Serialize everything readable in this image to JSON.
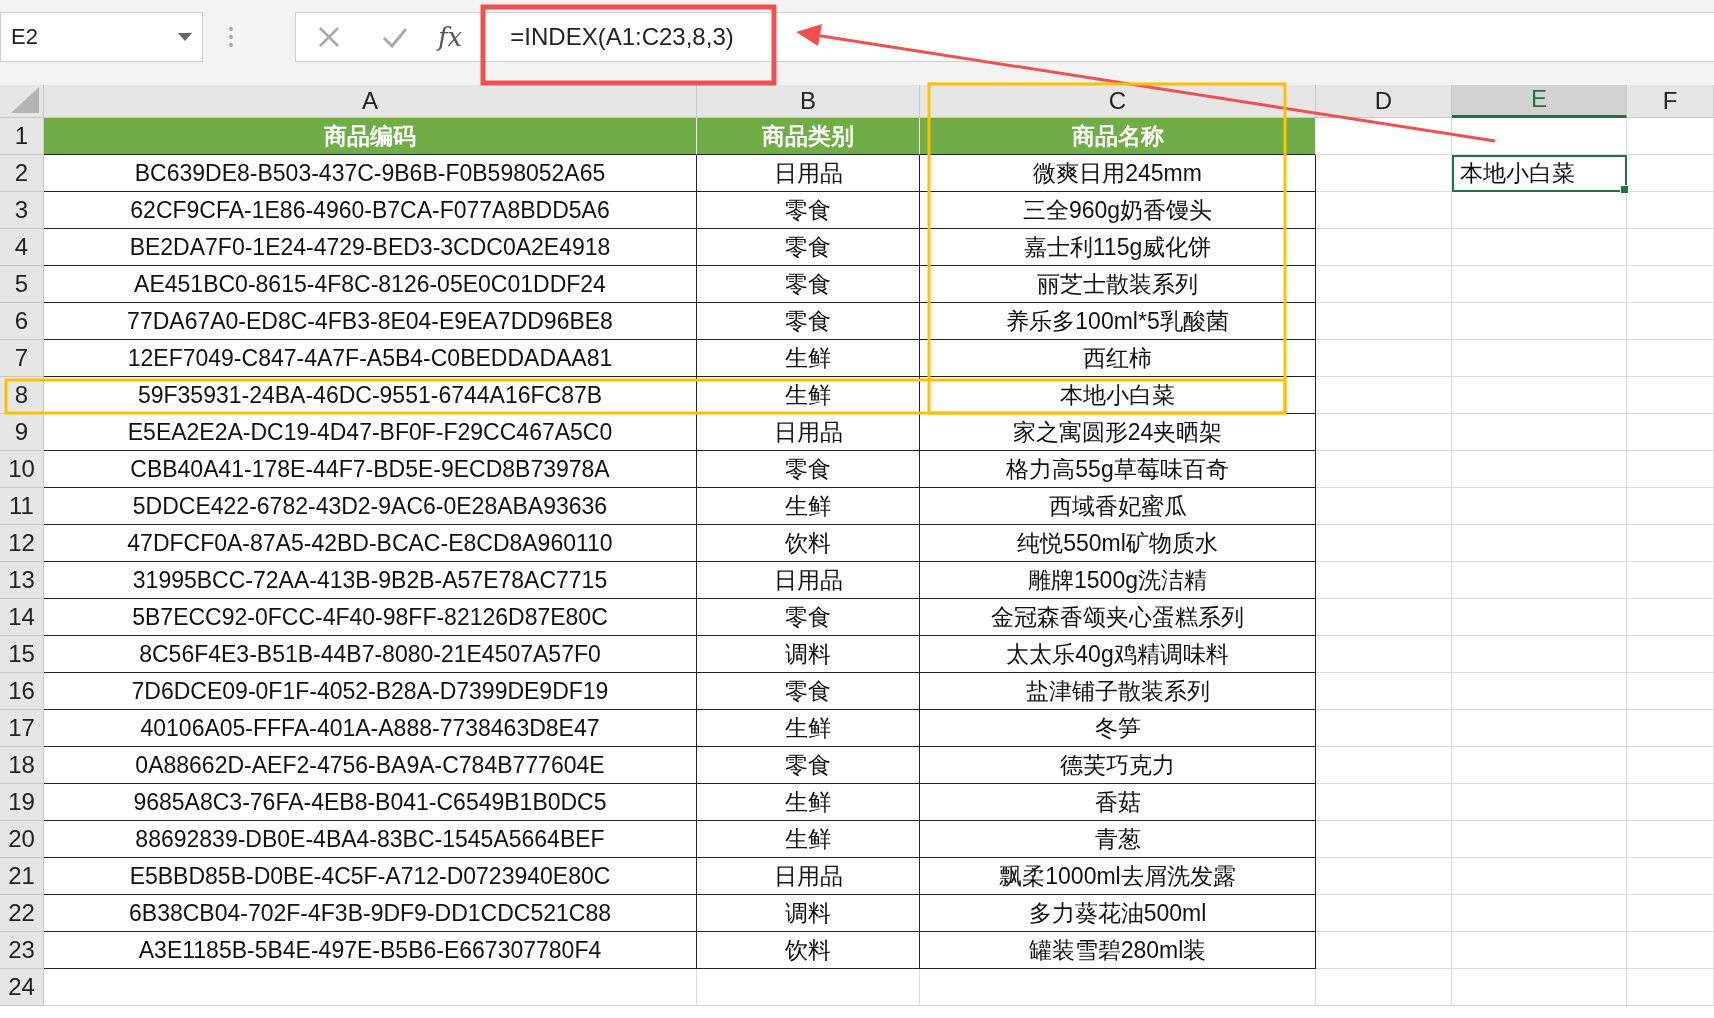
{
  "name_box": "E2",
  "formula_label": "fx",
  "formula": "=INDEX(A1:C23,8,3)",
  "columns": [
    {
      "label": "A",
      "selected": false
    },
    {
      "label": "B",
      "selected": false
    },
    {
      "label": "C",
      "selected": false
    },
    {
      "label": "D",
      "selected": false
    },
    {
      "label": "E",
      "selected": true
    },
    {
      "label": "F",
      "selected": false
    }
  ],
  "header": {
    "number": "1",
    "cells": [
      "商品编码",
      "商品类别",
      "商品名称"
    ]
  },
  "rows": [
    {
      "number": "2",
      "code": "BC639DE8-B503-437C-9B6B-F0B598052A65",
      "category": "日用品",
      "name": "微爽日用245mm"
    },
    {
      "number": "3",
      "code": "62CF9CFA-1E86-4960-B7CA-F077A8BDD5A6",
      "category": "零食",
      "name": "三全960g奶香馒头"
    },
    {
      "number": "4",
      "code": "BE2DA7F0-1E24-4729-BED3-3CDC0A2E4918",
      "category": "零食",
      "name": "嘉士利115g威化饼"
    },
    {
      "number": "5",
      "code": "AE451BC0-8615-4F8C-8126-05E0C01DDF24",
      "category": "零食",
      "name": "丽芝士散装系列"
    },
    {
      "number": "6",
      "code": "77DA67A0-ED8C-4FB3-8E04-E9EA7DD96BE8",
      "category": "零食",
      "name": "养乐多100ml*5乳酸菌"
    },
    {
      "number": "7",
      "code": "12EF7049-C847-4A7F-A5B4-C0BEDDADAA81",
      "category": "生鲜",
      "name": "西红柿"
    },
    {
      "number": "8",
      "code": "59F35931-24BA-46DC-9551-6744A16FC87B",
      "category": "生鲜",
      "name": "本地小白菜"
    },
    {
      "number": "9",
      "code": "E5EA2E2A-DC19-4D47-BF0F-F29CC467A5C0",
      "category": "日用品",
      "name": "家之寓圆形24夹晒架"
    },
    {
      "number": "10",
      "code": "CBB40A41-178E-44F7-BD5E-9ECD8B73978A",
      "category": "零食",
      "name": "格力高55g草莓味百奇"
    },
    {
      "number": "11",
      "code": "5DDCE422-6782-43D2-9AC6-0E28ABA93636",
      "category": "生鲜",
      "name": "西域香妃蜜瓜"
    },
    {
      "number": "12",
      "code": "47DFCF0A-87A5-42BD-BCAC-E8CD8A960110",
      "category": "饮料",
      "name": "纯悦550ml矿物质水"
    },
    {
      "number": "13",
      "code": "31995BCC-72AA-413B-9B2B-A57E78AC7715",
      "category": "日用品",
      "name": "雕牌1500g洗洁精"
    },
    {
      "number": "14",
      "code": "5B7ECC92-0FCC-4F40-98FF-82126D87E80C",
      "category": "零食",
      "name": "金冠森香颂夹心蛋糕系列"
    },
    {
      "number": "15",
      "code": "8C56F4E3-B51B-44B7-8080-21E4507A57F0",
      "category": "调料",
      "name": "太太乐40g鸡精调味料"
    },
    {
      "number": "16",
      "code": "7D6DCE09-0F1F-4052-B28A-D7399DE9DF19",
      "category": "零食",
      "name": "盐津铺子散装系列"
    },
    {
      "number": "17",
      "code": "40106A05-FFFA-401A-A888-7738463D8E47",
      "category": "生鲜",
      "name": "冬笋"
    },
    {
      "number": "18",
      "code": "0A88662D-AEF2-4756-BA9A-C784B777604E",
      "category": "零食",
      "name": "德芙巧克力"
    },
    {
      "number": "19",
      "code": "9685A8C3-76FA-4EB8-B041-C6549B1B0DC5",
      "category": "生鲜",
      "name": "香菇"
    },
    {
      "number": "20",
      "code": "88692839-DB0E-4BA4-83BC-1545A5664BEF",
      "category": "生鲜",
      "name": "青葱"
    },
    {
      "number": "21",
      "code": "E5BBD85B-D0BE-4C5F-A712-D0723940E80C",
      "category": "日用品",
      "name": "飘柔1000ml去屑洗发露"
    },
    {
      "number": "22",
      "code": "6B38CB04-702F-4F3B-9DF9-DD1CDC521C88",
      "category": "调料",
      "name": "多力葵花油500ml"
    },
    {
      "number": "23",
      "code": "A3E1185B-5B4E-497E-B5B6-E667307780F4",
      "category": "饮料",
      "name": "罐装雪碧280ml装"
    }
  ],
  "result_cell": {
    "value": "本地小白菜",
    "selected": true
  },
  "empty_rows": [
    "24"
  ]
}
